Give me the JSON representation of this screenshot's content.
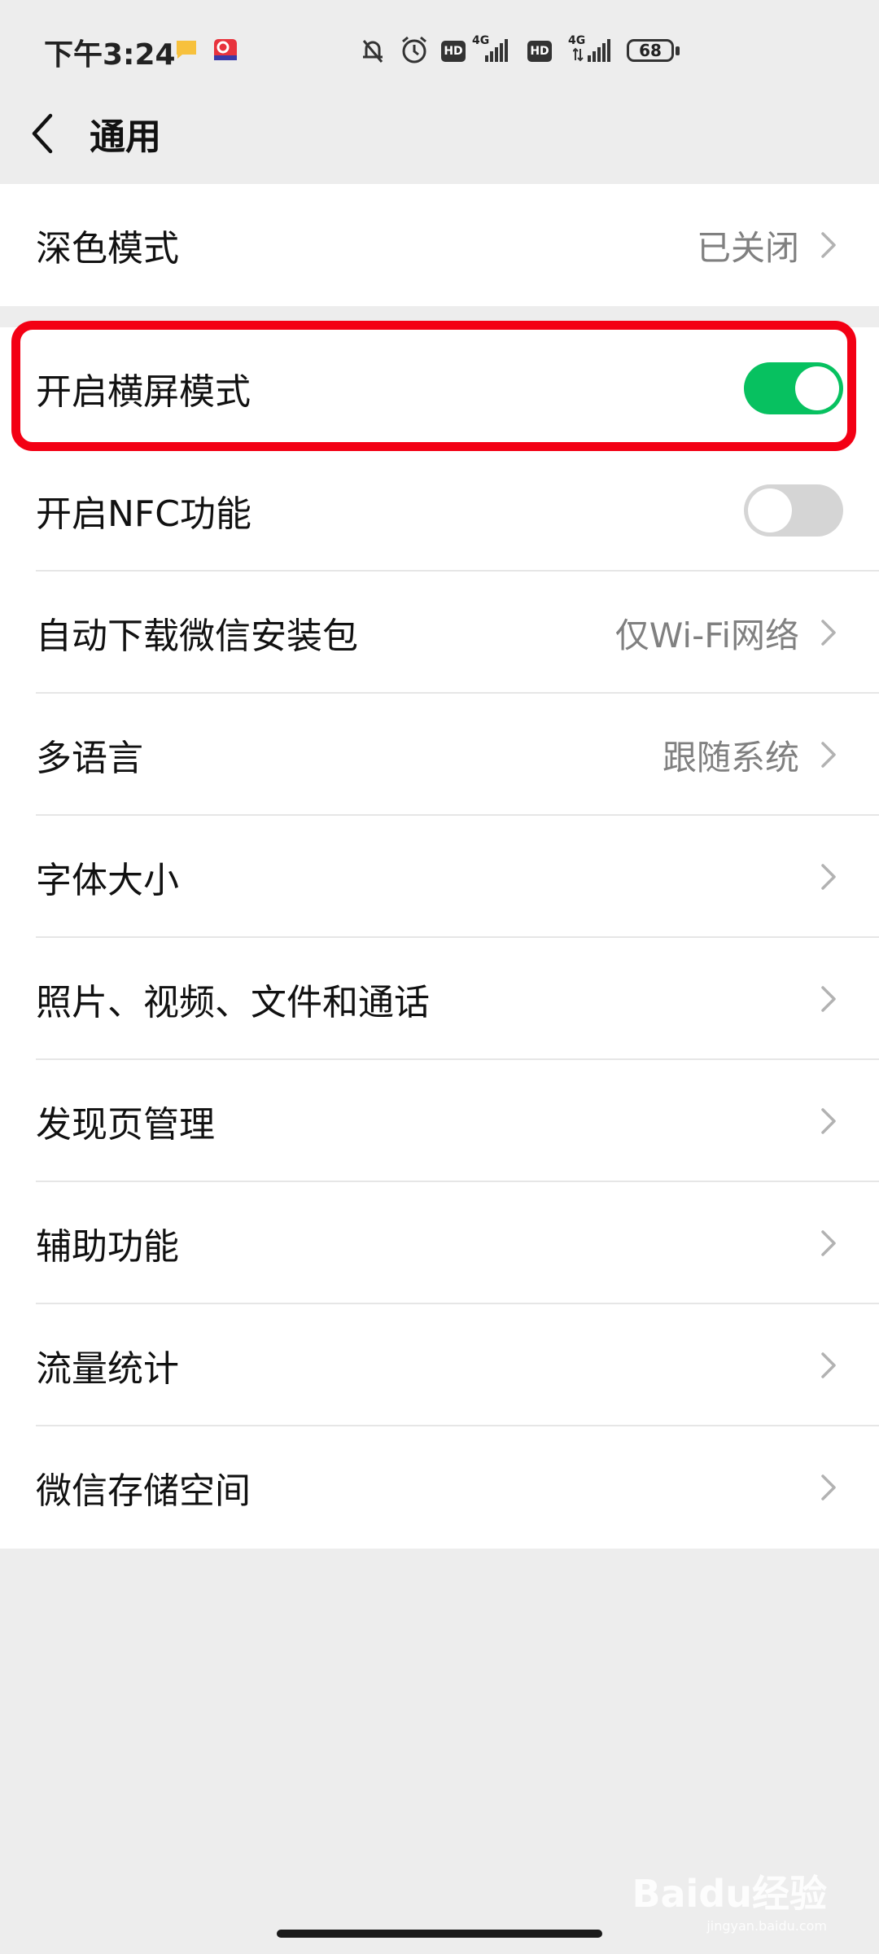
{
  "status_bar": {
    "time": "下午3:24",
    "network_1": "4G",
    "network_2": "4G",
    "hd_1": "HD",
    "hd_2": "HD",
    "battery": "68"
  },
  "header": {
    "title": "通用"
  },
  "settings": {
    "dark_mode": {
      "label": "深色模式",
      "value": "已关闭"
    },
    "landscape": {
      "label": "开启横屏模式",
      "toggle": "on"
    },
    "nfc": {
      "label": "开启NFC功能",
      "toggle": "off"
    },
    "auto_download": {
      "label": "自动下载微信安装包",
      "value": "仅Wi-Fi网络"
    },
    "language": {
      "label": "多语言",
      "value": "跟随系统"
    },
    "font_size": {
      "label": "字体大小"
    },
    "media": {
      "label": "照片、视频、文件和通话"
    },
    "discover": {
      "label": "发现页管理"
    },
    "accessibility": {
      "label": "辅助功能"
    },
    "traffic": {
      "label": "流量统计"
    },
    "storage": {
      "label": "微信存储空间"
    }
  },
  "watermark": {
    "brand": "Baidu经验",
    "url": "jingyan.baidu.com"
  },
  "colors": {
    "accent_green": "#07c160",
    "highlight_red": "#f30014",
    "background": "#ededed"
  }
}
